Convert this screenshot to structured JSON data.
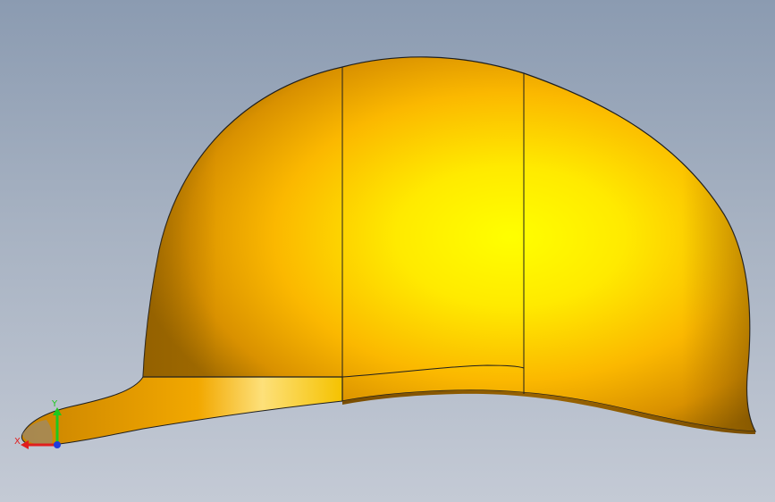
{
  "viewport": {
    "background_top": "#8b9bb1",
    "background_bottom": "#c4cad5"
  },
  "model": {
    "object": "cap",
    "shell_color": "#f0b400",
    "highlight_color": "#ffff00",
    "shadow_color": "#a06a00",
    "edge_color": "#1e1e1e"
  },
  "triad": {
    "x_label": "X",
    "y_label": "Y",
    "x_color": "#e01e1e",
    "y_color": "#1ec81e",
    "z_color": "#1e3cdc"
  }
}
